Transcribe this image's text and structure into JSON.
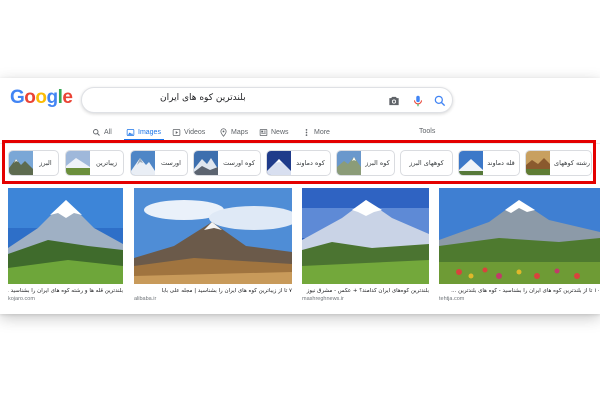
{
  "logo": {
    "letters": [
      "G",
      "o",
      "o",
      "g",
      "l",
      "e"
    ],
    "colors": [
      "#4285F4",
      "#EA4335",
      "#FBBC05",
      "#4285F4",
      "#34A853",
      "#EA4335"
    ]
  },
  "search": {
    "query": "بلندترین کوه های ایران"
  },
  "tabs": [
    {
      "label": "All",
      "icon": "search-icon"
    },
    {
      "label": "Images",
      "icon": "image-icon",
      "active": true
    },
    {
      "label": "Videos",
      "icon": "video-icon"
    },
    {
      "label": "Maps",
      "icon": "map-pin-icon"
    },
    {
      "label": "News",
      "icon": "news-icon"
    },
    {
      "label": "More",
      "icon": "more-icon"
    }
  ],
  "tools_label": "Tools",
  "chips": [
    {
      "label": "البرز"
    },
    {
      "label": "زیباترین"
    },
    {
      "label": "اورست"
    },
    {
      "label": "کوه اورست"
    },
    {
      "label": "کوه دماوند"
    },
    {
      "label": "کوه البرز"
    },
    {
      "label": "کوههای البرز"
    },
    {
      "label": "قله دماوند"
    },
    {
      "label": "رشته کوههای"
    }
  ],
  "results": [
    {
      "caption": "بلندترین قله ها و رشته کوه های ایران را بشناسید ...",
      "site": "kojaro.com"
    },
    {
      "caption": "۷ تا از زیباترین کوه های ایران را بشناسید | مجله علی بابا",
      "site": "alibaba.ir"
    },
    {
      "caption": "بلندترین کوه‌های ایران کدامند؟ + عکس - مشرق نیوز",
      "site": "mashreghnews.ir"
    },
    {
      "caption": "۱۰ تا از بلندترین کوه های ایران را بشناسید - کوه های بلندترین ...",
      "site": "tehtja.com"
    }
  ],
  "colors": {
    "accent": "#1a73e8",
    "highlight": "#e40000",
    "muted": "#5f6368"
  }
}
